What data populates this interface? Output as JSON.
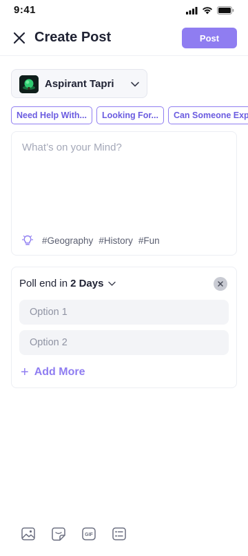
{
  "status_bar": {
    "time": "9:41",
    "icons": [
      "signal-icon",
      "wifi-icon",
      "battery-icon"
    ]
  },
  "header": {
    "close_icon": "close-icon",
    "title": "Create Post",
    "post_label": "Post"
  },
  "community": {
    "name": "Aspirant Tapri",
    "avatar_icon": "community-logo",
    "chevron_icon": "chevron-down-icon"
  },
  "prompt_chips": [
    "Need Help With...",
    "Looking For...",
    "Can Someone Explain"
  ],
  "composer": {
    "placeholder": "What’s on your Mind?",
    "bulb_icon": "lightbulb-icon",
    "tags": [
      "#Geography",
      "#History",
      "#Fun"
    ]
  },
  "poll": {
    "end_prefix": "Poll end in",
    "end_value": "2 Days",
    "options": [
      {
        "placeholder": "Option 1"
      },
      {
        "placeholder": "Option 2"
      }
    ],
    "add_more_label": "Add More",
    "close_icon": "close-icon"
  },
  "toolbar": {
    "items": [
      "image-icon",
      "sticker-icon",
      "gif-icon",
      "poll-icon"
    ],
    "gif_text": "GIF"
  },
  "colors": {
    "accent": "#8f7df1",
    "chip_text": "#6b5ce0",
    "text_primary": "#1f2233",
    "placeholder": "#a4a8b8"
  }
}
